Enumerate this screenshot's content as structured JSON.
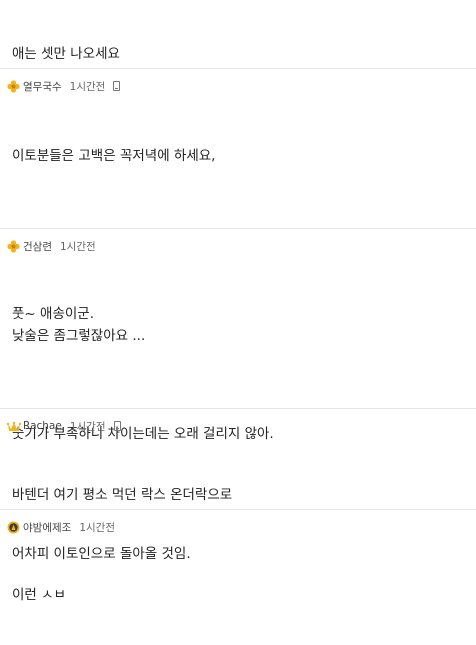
{
  "comments": [
    {
      "lines": [
        "애는 셋만 나오세요"
      ]
    },
    {
      "author": "열무국수",
      "time": "1시간전",
      "badge": "gold-flower-icon",
      "mobile": true,
      "lines": [
        "이토분들은 고백은 꼭저녁에 하세요,",
        "",
        "",
        "낮술은 좀그렇잖아요 ..."
      ]
    },
    {
      "author": "건삼련",
      "time": "1시간전",
      "badge": "gold-flower-icon",
      "mobile": false,
      "lines": [
        "풋~ 애송이군.",
        "",
        "숫기가 부족하니 차이는데는 오래 걸리지 않아.",
        "",
        "어차피 이토인으로 돌아올 것임."
      ]
    },
    {
      "author": "Rachae",
      "time": "1시간전",
      "badge": "gold-crown-icon",
      "mobile": true,
      "lines": [
        "바텐더 여기 평소 먹던 락스 온더락으로"
      ]
    },
    {
      "author": "야밤에제조",
      "time": "1시간전",
      "badge": "gold-medal-icon",
      "mobile": false,
      "lines": [
        "이런 ㅅㅂ"
      ]
    }
  ],
  "colors": {
    "badge_gold": "#f2b21b",
    "divider": "#e6e6e6",
    "text": "#222222",
    "meta": "#666666"
  }
}
